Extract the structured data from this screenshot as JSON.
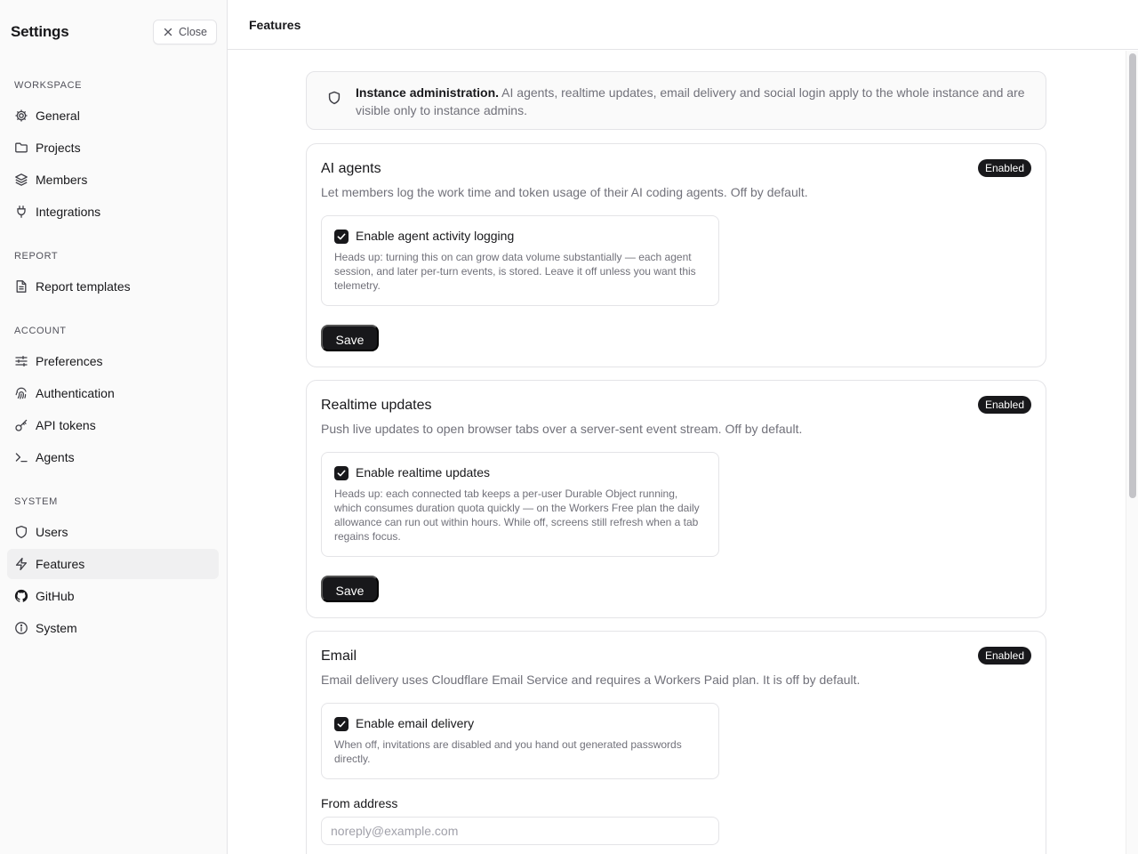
{
  "sidebar": {
    "title": "Settings",
    "close_label": "Close",
    "sections": [
      {
        "label": "WORKSPACE",
        "items": [
          {
            "label": "General",
            "icon": "gear-icon"
          },
          {
            "label": "Projects",
            "icon": "folder-icon"
          },
          {
            "label": "Members",
            "icon": "layers-icon"
          },
          {
            "label": "Integrations",
            "icon": "plug-icon"
          }
        ]
      },
      {
        "label": "REPORT",
        "items": [
          {
            "label": "Report templates",
            "icon": "file-text-icon"
          }
        ]
      },
      {
        "label": "ACCOUNT",
        "items": [
          {
            "label": "Preferences",
            "icon": "sliders-icon"
          },
          {
            "label": "Authentication",
            "icon": "fingerprint-icon"
          },
          {
            "label": "API tokens",
            "icon": "key-icon"
          },
          {
            "label": "Agents",
            "icon": "terminal-icon"
          }
        ]
      },
      {
        "label": "SYSTEM",
        "items": [
          {
            "label": "Users",
            "icon": "shield-icon"
          },
          {
            "label": "Features",
            "icon": "zap-icon",
            "active": true
          },
          {
            "label": "GitHub",
            "icon": "github-icon"
          },
          {
            "label": "System",
            "icon": "info-icon"
          }
        ]
      }
    ]
  },
  "header": {
    "title": "Features"
  },
  "notice": {
    "title": "Instance administration.",
    "text": " AI agents, realtime updates, email delivery and social login apply to the whole instance and are visible only to instance admins."
  },
  "cards": {
    "ai": {
      "title": "AI agents",
      "badge": "Enabled",
      "description": "Let members log the work time and token usage of their AI coding agents. Off by default.",
      "option_label": "Enable agent activity logging",
      "option_help": "Heads up: turning this on can grow data volume substantially — each agent session, and later per-turn events, is stored. Leave it off unless you want this telemetry.",
      "checked": true,
      "save_label": "Save"
    },
    "realtime": {
      "title": "Realtime updates",
      "badge": "Enabled",
      "description": "Push live updates to open browser tabs over a server-sent event stream. Off by default.",
      "option_label": "Enable realtime updates",
      "option_help": "Heads up: each connected tab keeps a per-user Durable Object running, which consumes duration quota quickly — on the Workers Free plan the daily allowance can run out within hours. While off, screens still refresh when a tab regains focus.",
      "checked": true,
      "save_label": "Save"
    },
    "email": {
      "title": "Email",
      "badge": "Enabled",
      "description": "Email delivery uses Cloudflare Email Service and requires a Workers Paid plan. It is off by default.",
      "option_label": "Enable email delivery",
      "option_help": "When off, invitations are disabled and you hand out generated passwords directly.",
      "checked": true,
      "from_label": "From address",
      "from_value": "",
      "from_placeholder": "noreply@example.com"
    }
  },
  "colors": {
    "accent": "#18181b",
    "muted_text": "#71717a",
    "border": "#e4e4e7",
    "sidebar_bg": "#fafafa"
  }
}
